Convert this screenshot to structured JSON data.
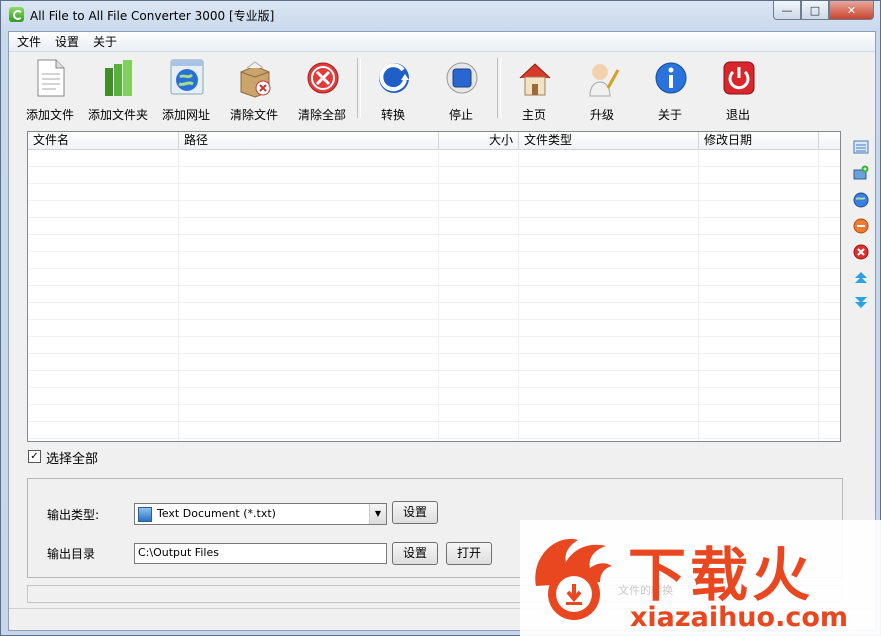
{
  "window": {
    "title": "All File to All File Converter 3000 [专业版]",
    "min": "—",
    "max": "□",
    "close": "✕"
  },
  "menu": [
    "文件",
    "设置",
    "关于"
  ],
  "toolbar": [
    {
      "label": "添加文件",
      "icon": "add-file-icon"
    },
    {
      "label": "添加文件夹",
      "icon": "add-folder-icon"
    },
    {
      "label": "添加网址",
      "icon": "add-url-icon"
    },
    {
      "label": "清除文件",
      "icon": "remove-file-icon"
    },
    {
      "label": "清除全部",
      "icon": "clear-all-icon"
    },
    {
      "label": "转换",
      "icon": "convert-icon"
    },
    {
      "label": "停止",
      "icon": "stop-icon"
    },
    {
      "label": "主页",
      "icon": "home-icon"
    },
    {
      "label": "升级",
      "icon": "upgrade-icon"
    },
    {
      "label": "关于",
      "icon": "info-icon"
    },
    {
      "label": "退出",
      "icon": "power-icon"
    }
  ],
  "list": {
    "columns": [
      "文件名",
      "路径",
      "大小",
      "文件类型",
      "修改日期"
    ],
    "rows": []
  },
  "select_all": {
    "label": "选择全部",
    "checked": true,
    "mark": "✓"
  },
  "output": {
    "type_label": "输出类型:",
    "type_value": "Text Document (*.txt)",
    "dir_label": "输出目录",
    "dir_value": "C:\\Output Files",
    "settings_button": "设置",
    "settings_button2": "设置",
    "open_button": "打开"
  },
  "watermark": {
    "title": "下载火",
    "url": "xiazaihuo.com",
    "sub": "文件的转换"
  }
}
